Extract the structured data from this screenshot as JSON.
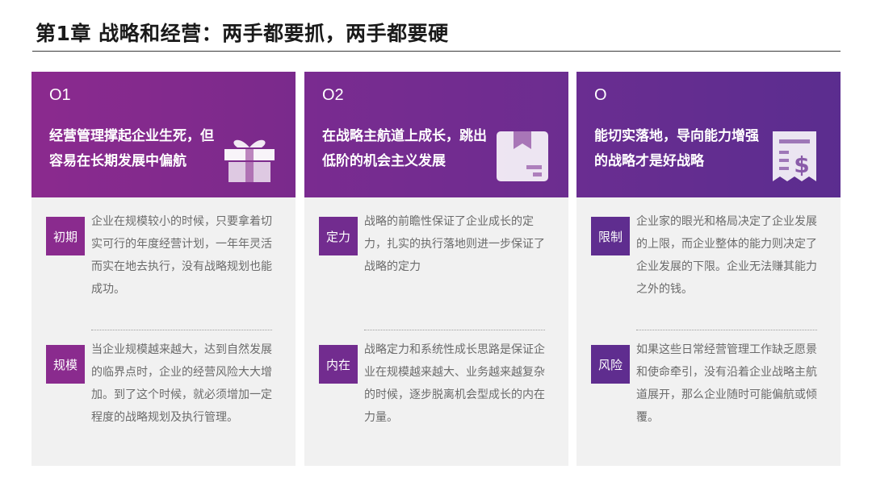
{
  "title": "第1章 战略和经营：两手都要抓，两手都要硬",
  "cards": [
    {
      "number": "O1",
      "headline": "经营管理撑起企业生死，但容易在长期发展中偏航",
      "icon": "gift-icon",
      "sections": [
        {
          "tag": "初期",
          "text": "企业在规模较小的时候，只要拿着切实可行的年度经营计划，一年年灵活而实在地去执行，没有战略规划也能成功。"
        },
        {
          "tag": "规模",
          "text": "当企业规模越来越大，达到自然发展的临界点时，企业的经营风险大大增加。到了这个时候，就必须增加一定程度的战略规划及执行管理。"
        }
      ]
    },
    {
      "number": "O2",
      "headline": "在战略主航道上成长，跳出低阶的机会主义发展",
      "icon": "package-icon",
      "sections": [
        {
          "tag": "定力",
          "text": "战略的前瞻性保证了企业成长的定力，扎实的执行落地则进一步保证了战略的定力"
        },
        {
          "tag": "内在",
          "text": "战略定力和系统性成长思路是保证企业在规模越来越大、业务越来越复杂的时候，逐步脱离机会型成长的内在力量。"
        }
      ]
    },
    {
      "number": "O",
      "headline": "能切实落地，导向能力增强的战略才是好战略",
      "icon": "dollar-receipt-icon",
      "sections": [
        {
          "tag": "限制",
          "text": "企业家的眼光和格局决定了企业发展的上限，而企业整体的能力则决定了企业发展的下限。企业无法赚其能力之外的钱。"
        },
        {
          "tag": "风险",
          "text": "如果这些日常经营管理工作缺乏愿景和使命牵引，没有沿着企业战略主航道展开，那么企业随时可能偏航或倾覆。"
        }
      ]
    }
  ]
}
